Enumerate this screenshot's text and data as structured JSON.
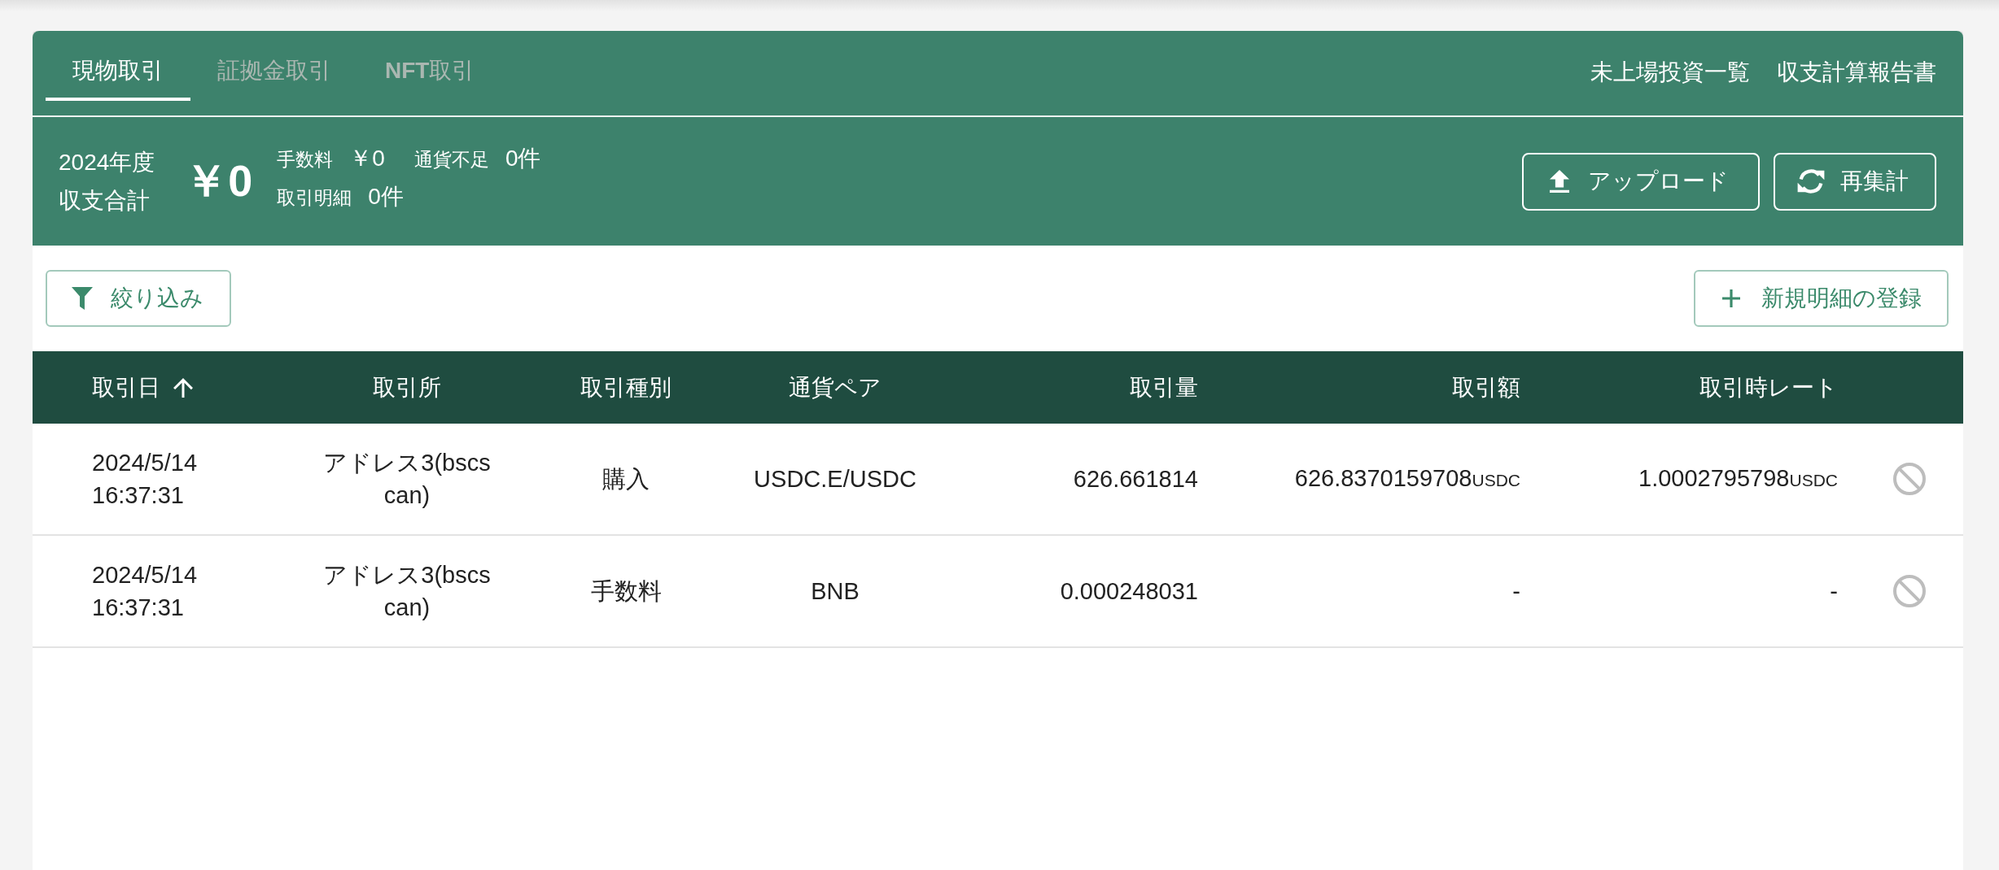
{
  "tabs": [
    {
      "label": "現物取引",
      "selected": true
    },
    {
      "label": "証拠金取引",
      "selected": false
    },
    {
      "label": "**NFT**取引",
      "selected": false
    }
  ],
  "header_links": [
    {
      "label": "未上場投資一覧"
    },
    {
      "label": "収支計算報告書"
    }
  ],
  "summary": {
    "period": "2024年度",
    "title": "収支合計",
    "total": "￥0",
    "stat_lines": [
      [
        {
          "label": "手数料",
          "value": "￥0"
        },
        {
          "label": "通貨不足",
          "value": "0件"
        }
      ],
      [
        {
          "label": "取引明細",
          "value": "0件"
        }
      ]
    ],
    "actions": [
      {
        "kind": "upload",
        "label": "アップロード"
      },
      {
        "kind": "recalculate",
        "label": "再集計"
      }
    ]
  },
  "toolbar": {
    "filter_button": "絞り込み",
    "add_button": "新規明細の登録"
  },
  "table": {
    "columns": [
      {
        "label": "取引日",
        "sorted": true
      },
      {
        "label": "取引所",
        "sorted": false
      },
      {
        "label": "取引種別",
        "sorted": false
      },
      {
        "label": "通貨ペア",
        "sorted": false
      },
      {
        "label": "取引量",
        "sorted": false
      },
      {
        "label": "取引額",
        "sorted": false
      },
      {
        "label": "取引時レート",
        "sorted": false
      }
    ],
    "rows": [
      {
        "datetime": "2024/5/14 16:37:31",
        "exchange": "アドレス3(bscscan)",
        "type": "購入",
        "pair": "USDC.E/USDC",
        "quantity": "626.661814",
        "amount": "626.8370159708",
        "amount_unit": "USDC",
        "rate": "1.0002795798",
        "rate_unit": "USDC"
      },
      {
        "datetime": "2024/5/14 16:37:31",
        "exchange": "アドレス3(bscscan)",
        "type": "手数料",
        "pair": "BNB",
        "quantity": "0.000248031",
        "amount": "-",
        "rate": "-"
      }
    ]
  }
}
